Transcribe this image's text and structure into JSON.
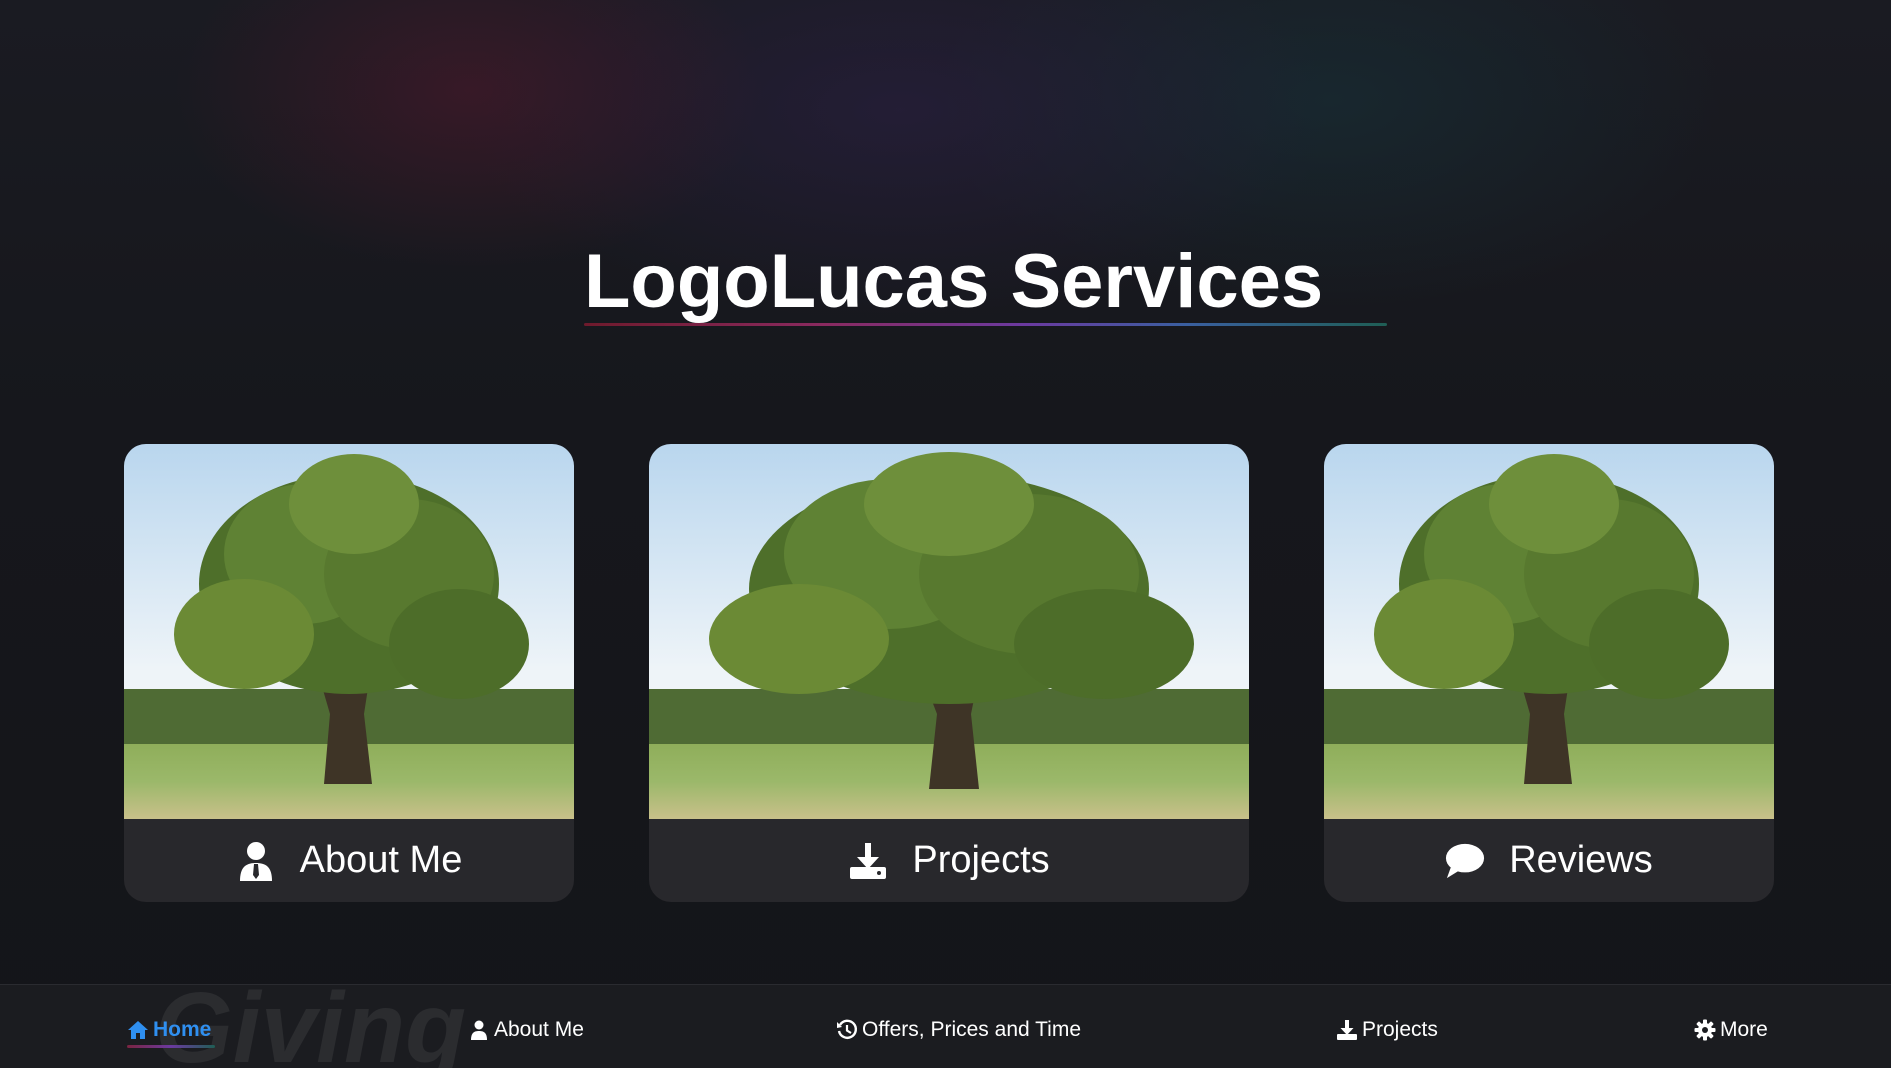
{
  "hero": {
    "title": "LogoLucas Services"
  },
  "cards": [
    {
      "label": "About Me",
      "icon": "person-tie-icon"
    },
    {
      "label": "Projects",
      "icon": "download-tray-icon"
    },
    {
      "label": "Reviews",
      "icon": "speech-bubble-icon"
    }
  ],
  "nav": {
    "watermark": "Giving",
    "items": [
      {
        "label": "Home",
        "icon": "home-icon",
        "active": true
      },
      {
        "label": "About Me",
        "icon": "person-icon"
      },
      {
        "label": "Offers, Prices and Time",
        "icon": "history-icon"
      },
      {
        "label": "Projects",
        "icon": "download-icon"
      },
      {
        "label": "More",
        "icon": "gear-icon"
      }
    ]
  },
  "colors": {
    "background": "#15161b",
    "card": "#28282c",
    "navbar": "#1b1c20",
    "active_link": "#2f8ff0"
  }
}
